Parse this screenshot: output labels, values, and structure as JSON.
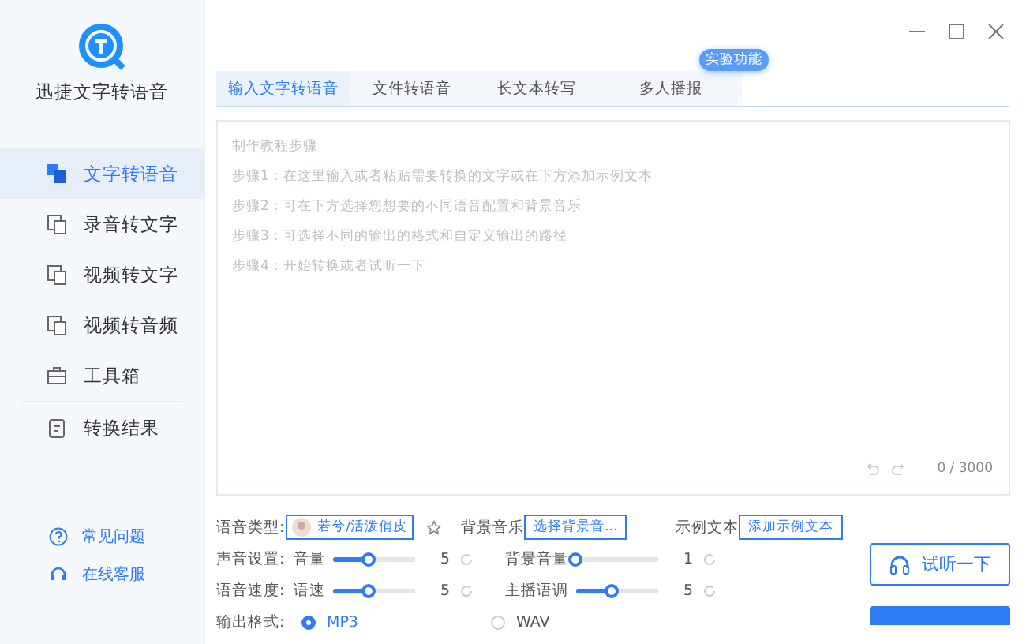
{
  "app": {
    "name": "迅捷文字转语音"
  },
  "sidebar": {
    "items": [
      {
        "label": "文字转语音",
        "selected": true
      },
      {
        "label": "录音转文字",
        "selected": false
      },
      {
        "label": "视频转文字",
        "selected": false
      },
      {
        "label": "视频转音频",
        "selected": false
      },
      {
        "label": "工具箱",
        "selected": false
      },
      {
        "label": "转换结果",
        "selected": false
      }
    ],
    "footer_links": [
      {
        "label": "常见问题"
      },
      {
        "label": "在线客服"
      }
    ]
  },
  "tabs": [
    {
      "label": "输入文字转语音",
      "selected": true
    },
    {
      "label": "文件转语音",
      "selected": false
    },
    {
      "label": "长文本转写",
      "selected": false
    },
    {
      "label": "多人播报",
      "selected": false,
      "badge": "实验功能"
    }
  ],
  "editor": {
    "placeholder_lines": [
      "制作教程步骤",
      "步骤1：在这里输入或者粘贴需要转换的文字或在下方添加示例文本",
      "步骤2：可在下方选择您想要的不同语音配置和背景音乐",
      "步骤3：可选择不同的输出的格式和自定义输出的路径",
      "步骤4：开始转换或者试听一下"
    ],
    "counter": "0 / 3000"
  },
  "settings": {
    "voice_type_label": "语音类型:",
    "voice": "若兮/活泼俏皮",
    "bg_music_label": "背景音乐",
    "bg_music_button": "选择背景音...",
    "sample_label": "示例文本",
    "sample_button": "添加示例文本",
    "sound_label": "声音设置:",
    "speed_label": "语音速度:",
    "format_label": "输出格式:",
    "sliders": [
      {
        "label": "音量",
        "level": 0.45,
        "reading": "5"
      },
      {
        "label": "背景音量",
        "level": 0,
        "reading": "1"
      },
      {
        "label": "语速",
        "level": 0.45,
        "reading": "5"
      },
      {
        "label": "主播语调",
        "level": 0.45,
        "reading": "5"
      }
    ],
    "formats": [
      {
        "label": "MP3",
        "selected": true
      },
      {
        "label": "WAV",
        "selected": false
      }
    ]
  },
  "actions": {
    "listen_button": "试听一下"
  }
}
